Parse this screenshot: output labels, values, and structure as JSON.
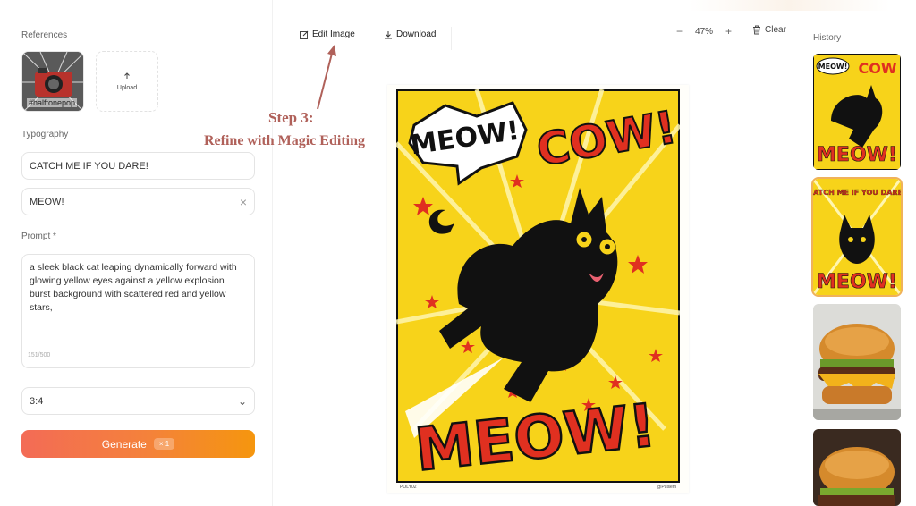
{
  "references": {
    "label": "References",
    "thumb_caption": "#halftonepop",
    "upload_label": "Upload"
  },
  "typography": {
    "label": "Typography",
    "line1": "CATCH ME IF YOU DARE!",
    "line2": "MEOW!"
  },
  "prompt": {
    "label": "Prompt *",
    "text": "a sleek black cat leaping dynamically forward with glowing yellow eyes against a yellow explosion burst background with scattered red and yellow stars,",
    "counter": "151/500"
  },
  "aspect": {
    "value": "3:4"
  },
  "generate": {
    "label": "Generate",
    "badge": "× 1"
  },
  "toolbar": {
    "edit_label": "Edit Image",
    "download_label": "Download",
    "zoom_minus": "−",
    "zoom_value": "47%",
    "zoom_plus": "+",
    "clear_label": "Clear"
  },
  "annotation": {
    "title": "Step 3:",
    "subtitle": "Refine with Magic Editing"
  },
  "poster": {
    "bubble_text": "MEOW!",
    "cow_text": "COW!",
    "bottom_text": "MEOW!",
    "footer_left": "POLY02",
    "footer_right": "@Pulsem",
    "bg_color": "#f7d31a",
    "accent_color": "#e03020"
  },
  "history": {
    "label": "History",
    "items": [
      {
        "kind": "cat-poster",
        "caption": "MEOW!"
      },
      {
        "kind": "cat-poster",
        "caption": "CATCH ME IF YOU DARE!"
      },
      {
        "kind": "burger-photo"
      },
      {
        "kind": "burger-photo"
      }
    ]
  }
}
